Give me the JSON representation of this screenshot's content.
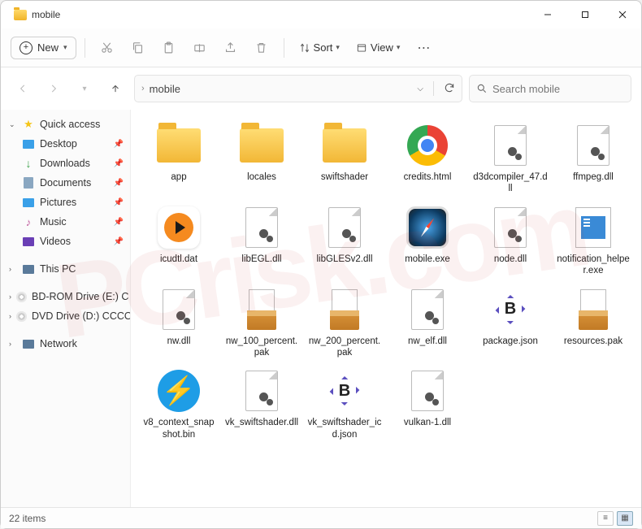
{
  "titlebar": {
    "title": "mobile"
  },
  "toolbar": {
    "new_label": "New",
    "sort_label": "Sort",
    "view_label": "View"
  },
  "breadcrumb": {
    "current": "mobile"
  },
  "search": {
    "placeholder": "Search mobile"
  },
  "sidebar": {
    "quick_access": "Quick access",
    "desktop": "Desktop",
    "downloads": "Downloads",
    "documents": "Documents",
    "pictures": "Pictures",
    "music": "Music",
    "videos": "Videos",
    "this_pc": "This PC",
    "bdrom": "BD-ROM Drive (E:) C",
    "dvd": "DVD Drive (D:) CCCO",
    "network": "Network"
  },
  "files": {
    "f0": "app",
    "f1": "locales",
    "f2": "swiftshader",
    "f3": "credits.html",
    "f4": "d3dcompiler_47.dll",
    "f5": "ffmpeg.dll",
    "f6": "icudtl.dat",
    "f7": "libEGL.dll",
    "f8": "libGLESv2.dll",
    "f9": "mobile.exe",
    "f10": "node.dll",
    "f11": "notification_helper.exe",
    "f12": "nw.dll",
    "f13": "nw_100_percent.pak",
    "f14": "nw_200_percent.pak",
    "f15": "nw_elf.dll",
    "f16": "package.json",
    "f17": "resources.pak",
    "f18": "v8_context_snapshot.bin",
    "f19": "vk_swiftshader.dll",
    "f20": "vk_swiftshader_icd.json",
    "f21": "vulkan-1.dll"
  },
  "statusbar": {
    "count": "22 items"
  }
}
